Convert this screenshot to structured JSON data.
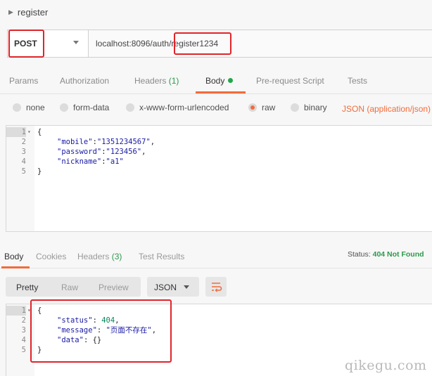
{
  "request": {
    "name": "register",
    "method": "POST",
    "url": "localhost:8096/auth/register1234"
  },
  "request_tabs": [
    {
      "label": "Params"
    },
    {
      "label": "Authorization"
    },
    {
      "label": "Headers",
      "count": "(1)"
    },
    {
      "label": "Body"
    },
    {
      "label": "Pre-request Script"
    },
    {
      "label": "Tests"
    }
  ],
  "body_types": [
    {
      "label": "none"
    },
    {
      "label": "form-data"
    },
    {
      "label": "x-www-form-urlencoded"
    },
    {
      "label": "raw",
      "selected": true
    },
    {
      "label": "binary"
    }
  ],
  "body_format": "JSON (application/json)",
  "request_body": {
    "line_numbers": [
      "1",
      "2",
      "3",
      "4",
      "5"
    ],
    "open": "{",
    "close": "}",
    "fields": [
      {
        "key": "\"mobile\"",
        "sep": ":",
        "value": "\"1351234567\"",
        "tail": ","
      },
      {
        "key": "\"password\"",
        "sep": ":",
        "value": "\"123456\"",
        "tail": ","
      },
      {
        "key": "\"nickname\"",
        "sep": ":",
        "value": "\"a1\"",
        "tail": ""
      }
    ]
  },
  "response_tabs": [
    {
      "label": "Body"
    },
    {
      "label": "Cookies"
    },
    {
      "label": "Headers",
      "count": "(3)"
    },
    {
      "label": "Test Results"
    }
  ],
  "status": {
    "label": "Status:",
    "value": "404 Not Found"
  },
  "view_modes": [
    "Pretty",
    "Raw",
    "Preview"
  ],
  "response_format": "JSON",
  "response_body": {
    "line_numbers": [
      "1",
      "2",
      "3",
      "4",
      "5"
    ],
    "open": "{",
    "close": "}",
    "fields": [
      {
        "key": "\"status\"",
        "sep": ": ",
        "value": "404",
        "tail": ","
      },
      {
        "key": "\"message\"",
        "sep": ": ",
        "value": "\"页面不存在\"",
        "tail": ","
      },
      {
        "key": "\"data\"",
        "sep": ": ",
        "value": "{}",
        "tail": ""
      }
    ]
  },
  "watermark": "qikegu.com",
  "colors": {
    "accent": "#f26b3a",
    "success": "#2b9a4a",
    "highlight_box": "#e0242a"
  },
  "icons": [
    "caret-right-icon",
    "chevron-down-icon",
    "fold-arrow-icon",
    "wrap-lines-icon",
    "radio-icon"
  ]
}
